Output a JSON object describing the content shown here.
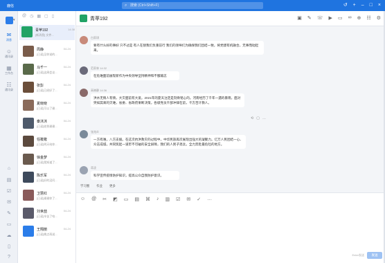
{
  "titlebar": {
    "app_name": "鹿信",
    "search_placeholder": "搜索 (Ctrl+Shift+F)",
    "icons": [
      "history-icon",
      "add-icon",
      "minimize-icon",
      "maximize-icon",
      "close-icon"
    ],
    "color": "#1f74e0"
  },
  "rail": {
    "items": [
      {
        "label": "消息",
        "icon": "chat-icon",
        "active": true
      },
      {
        "label": "通讯录",
        "icon": "contacts-icon",
        "active": false
      },
      {
        "label": "工作台",
        "icon": "workbench-icon",
        "active": false
      },
      {
        "label": "通讯录",
        "icon": "org-icon",
        "active": false
      }
    ],
    "bottom_icons": [
      "home-icon",
      "doc-icon",
      "todo-icon",
      "mail-icon",
      "pin-icon",
      "folder-icon",
      "cloud-icon",
      "mobile-icon",
      "help-icon",
      "settings-icon"
    ]
  },
  "conversations": [
    {
      "name": "青苹192",
      "preview": "[新消息] 文件...",
      "time": "14:38",
      "color": "#21a366",
      "active": true
    },
    {
      "name": "周静",
      "preview": "[已读]见你说的...",
      "time": "04-24",
      "color": "#7a5c4a"
    },
    {
      "name": "马千一",
      "preview": "[已读]这周会议...",
      "time": "04-24",
      "color": "#5a6a4a"
    },
    {
      "name": "张彭",
      "preview": "[已读]已经好了...",
      "time": "04-24",
      "color": "#6b4e3a"
    },
    {
      "name": "夏晓晓",
      "preview": "[已读]可以了谢...",
      "time": "04-24",
      "color": "#8a6a5a"
    },
    {
      "name": "秦沐沐",
      "preview": "[已读]收到谢谢...",
      "time": "04-24",
      "color": "#4e5a6b"
    },
    {
      "name": "任筱筱",
      "preview": "[已读]明天给你...",
      "time": "04-24",
      "color": "#5c4a3e"
    },
    {
      "name": "徐金梦",
      "preview": "[已读]我知道了...",
      "time": "04-24",
      "color": "#6a5a4e"
    },
    {
      "name": "陈乐军",
      "preview": "[已读]好的没问...",
      "time": "04-24",
      "color": "#3e4a5c"
    },
    {
      "name": "卫慧红",
      "preview": "[已读]谢谢你了...",
      "time": "04-24",
      "color": "#8a5a5a"
    },
    {
      "name": "刘世喆",
      "preview": "[已读]辛苦了哈...",
      "time": "04-24",
      "color": "#5a5a6a"
    },
    {
      "name": "王翔丽",
      "preview": "[已读]晚点再说...",
      "time": "04-24",
      "color": "#2b7de9"
    }
  ],
  "chat": {
    "title": "青苹192",
    "messages": [
      {
        "sender": "白家琪",
        "text": "要有什么好的事好 只不过是 有人在替我们负重前行 我们的领导们为确保我们团结一致，将党建有机融合，无事而动起来。",
        "color": "#c88a7a"
      },
      {
        "sender": "范家林 14:32",
        "text": "在危难面前展现新作为中央领导坚持精神和不服输志",
        "color": "#6a6a7a"
      },
      {
        "sender": "高晓静 14:36",
        "text": "洪水无情人有情，大灾面前有大爱。2021年的夏天注定是刻骨铭心的。河南经历了千年一遇的暴雨，面对突如其来的灾难，省委、省政府果断决策，各级党员干部冲锋在前，千方百计救人。",
        "color": "#8a6a6a"
      },
      {
        "sender": "张兆炎",
        "text": "一方有难，八方支援。在这次抗洪救灾的过程中，中华民族再次展现出强大的凝聚力。亿万人民团结一心、众志成城，共同筑起一道牢不可破的安全屏障，我们的人民子弟兵，全力奔赴最危险的地方。",
        "color": "#7a8a9a"
      },
      {
        "sender": "蒋凌",
        "text": "科学宣传疫情防护知识，提高公众自我防护意识。",
        "color": "#9aa3b2"
      }
    ],
    "quick_replies": [
      "学习圈",
      "作业",
      "更多"
    ],
    "input_icons": [
      "emoji-icon",
      "at-icon",
      "scissors-icon",
      "image-icon",
      "file-icon",
      "folder-icon",
      "code-icon",
      "mic-icon",
      "poll-icon",
      "task-icon",
      "mail-icon",
      "check-icon",
      "more-icon"
    ],
    "send_hint": "Enter发送",
    "send_label": "发送",
    "header_icons": [
      "chat-bubble-icon",
      "note-icon",
      "phone-icon",
      "video-icon",
      "folder-icon",
      "link-icon",
      "add-person-icon",
      "group-icon",
      "settings-icon"
    ]
  }
}
